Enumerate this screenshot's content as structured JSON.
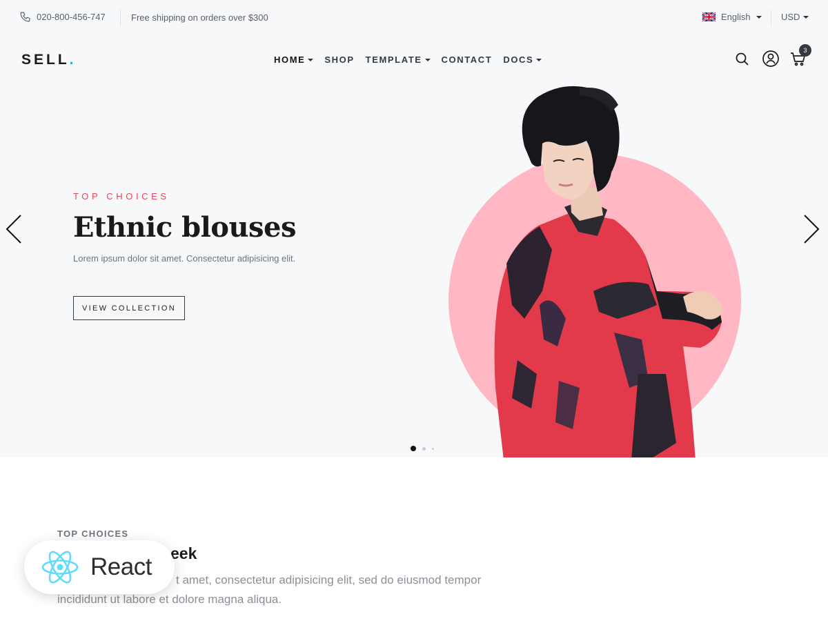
{
  "topbar": {
    "phone": "020-800-456-747",
    "shipping": "Free shipping on orders over $300",
    "language": "English",
    "currency": "USD"
  },
  "header": {
    "logo": "SELL",
    "logo_dot": ".",
    "nav": [
      {
        "label": "HOME",
        "dropdown": true
      },
      {
        "label": "SHOP",
        "dropdown": false
      },
      {
        "label": "TEMPLATE",
        "dropdown": true
      },
      {
        "label": "CONTACT",
        "dropdown": false
      },
      {
        "label": "DOCS",
        "dropdown": true
      }
    ],
    "cart_count": "3"
  },
  "hero": {
    "eyebrow": "TOP CHOICES",
    "title": "Ethnic blouses",
    "subtitle": "Lorem ipsum dolor sit amet. Consectetur adipisicing elit.",
    "button": "VIEW COLLECTION",
    "slides_total": 3,
    "active_slide": 1
  },
  "section": {
    "eyebrow": "TOP CHOICES",
    "title_visible": "eek",
    "text_line1": "t amet, consectetur adipisicing elit, sed do eiusmod tempor",
    "text_line2": "incididunt ut labore et dolore magna aliqua."
  },
  "overlay": {
    "label": "React"
  },
  "colors": {
    "accent": "#e0475a",
    "circle": "#ffb8c3",
    "logo_dot": "#2aa7c9",
    "react": "#61dafb"
  }
}
